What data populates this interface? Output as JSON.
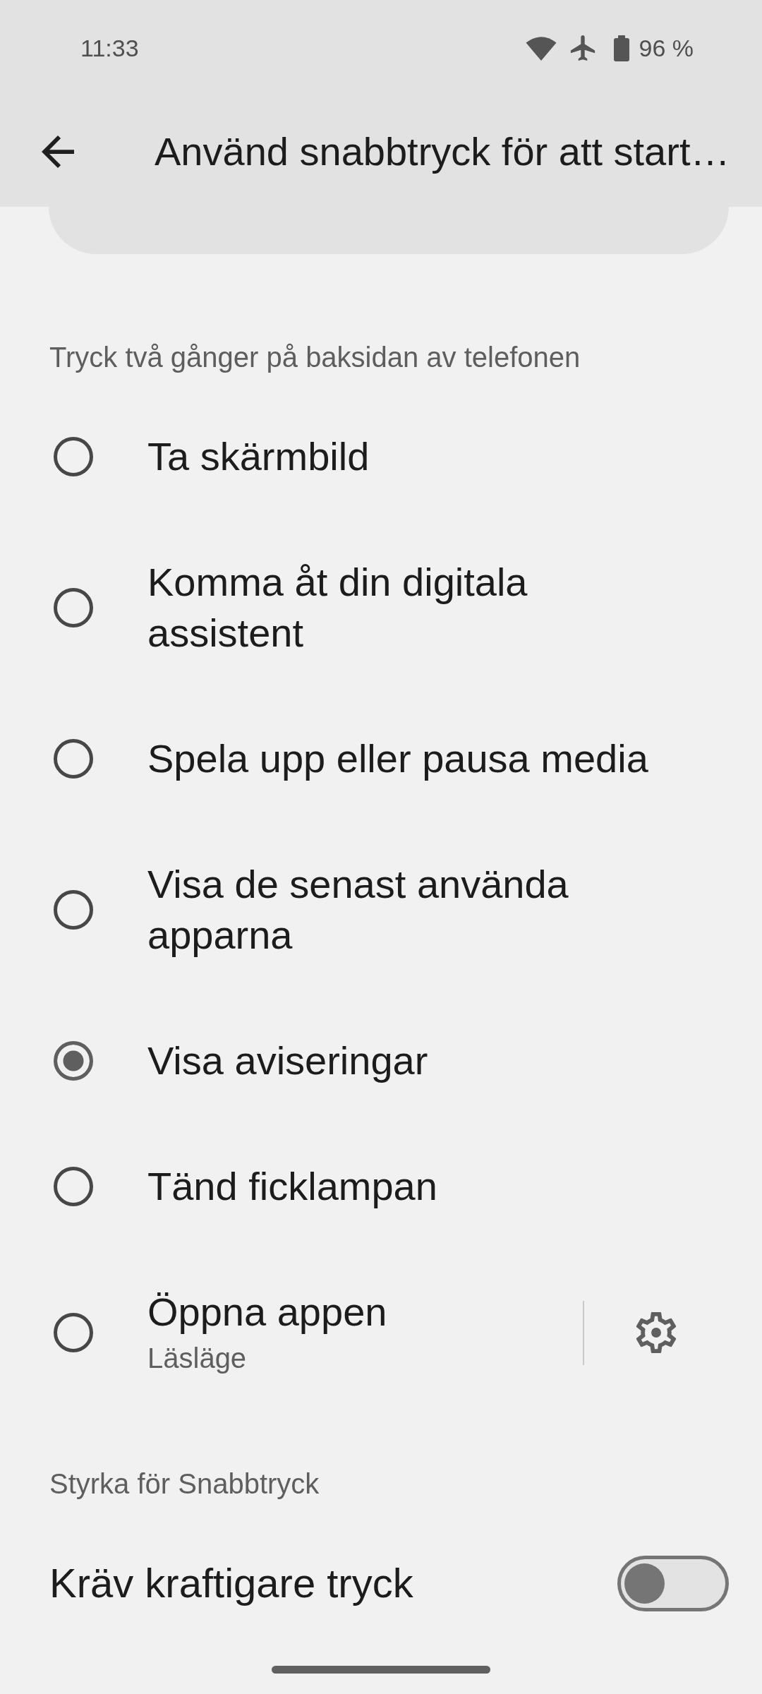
{
  "status_bar": {
    "time": "11:33",
    "battery": "96 %"
  },
  "app_bar": {
    "title": "Använd snabbtryck för att start…"
  },
  "sections": [
    {
      "kind": "radio-group",
      "title": "Tryck två gånger på baksidan av telefonen",
      "items": [
        {
          "label": "Ta skärmbild",
          "selected": false
        },
        {
          "label": "Komma åt din digitala assistent",
          "selected": false
        },
        {
          "label": "Spela upp eller pausa media",
          "selected": false
        },
        {
          "label": "Visa de senast använda apparna",
          "selected": false
        },
        {
          "label": "Visa aviseringar",
          "selected": true
        },
        {
          "label": "Tänd ficklampan",
          "selected": false
        },
        {
          "label": "Öppna appen",
          "subtitle": "Läsläge",
          "selected": false,
          "settings": true
        }
      ]
    },
    {
      "kind": "switch-group",
      "title": "Styrka för Snabbtryck",
      "items": [
        {
          "label": "Kräv kraftigare tryck",
          "on": false
        }
      ]
    }
  ]
}
